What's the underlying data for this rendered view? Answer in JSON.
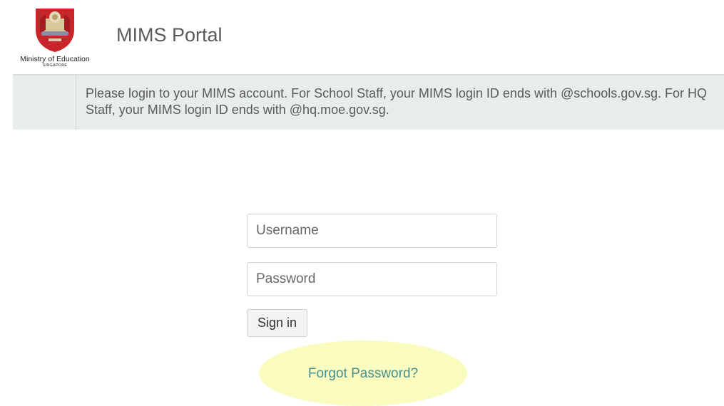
{
  "header": {
    "logo_icon": "moe-crest-icon",
    "logo_line1": "Ministry of Education",
    "logo_line2": "SINGAPORE",
    "title": "MIMS Portal"
  },
  "notice": {
    "text": "Please login to your MIMS account. For School Staff, your MIMS login ID ends with @schools.gov.sg. For HQ Staff, your MIMS login ID ends with @hq.moe.gov.sg."
  },
  "login": {
    "username_placeholder": "Username",
    "password_placeholder": "Password",
    "signin_label": "Sign in",
    "forgot_label": "Forgot Password?"
  },
  "colors": {
    "notice_bg": "#e8ecec",
    "link": "#4b8f8c",
    "highlight": "#fafcbf",
    "crest_red": "#c8262a"
  }
}
